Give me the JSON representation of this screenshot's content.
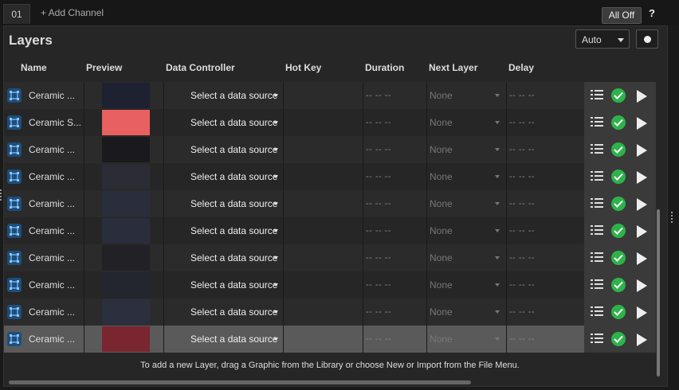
{
  "channel_tab": "01",
  "add_channel": "+ Add Channel",
  "all_off": "All Off",
  "help": "?",
  "panel_title": "Layers",
  "mode_select": "Auto",
  "columns": {
    "name": "Name",
    "preview": "Preview",
    "data_controller": "Data Controller",
    "hot_key": "Hot Key",
    "duration": "Duration",
    "next_layer": "Next Layer",
    "delay": "Delay"
  },
  "rows": [
    {
      "name": "Ceramic ...",
      "data_controller": "Select a data source",
      "duration": "-- -- --",
      "next_layer": "None",
      "delay": "-- -- --",
      "preview_color": "#1e2230"
    },
    {
      "name": "Ceramic S...",
      "data_controller": "Select a data source",
      "duration": "-- -- --",
      "next_layer": "None",
      "delay": "-- -- --",
      "preview_color": "#e86060"
    },
    {
      "name": "Ceramic ...",
      "data_controller": "Select a data source",
      "duration": "-- -- --",
      "next_layer": "None",
      "delay": "-- -- --",
      "preview_color": "#1a1a1e"
    },
    {
      "name": "Ceramic ...",
      "data_controller": "Select a data source",
      "duration": "-- -- --",
      "next_layer": "None",
      "delay": "-- -- --",
      "preview_color": "#2c2c36"
    },
    {
      "name": "Ceramic ...",
      "data_controller": "Select a data source",
      "duration": "-- -- --",
      "next_layer": "None",
      "delay": "-- -- --",
      "preview_color": "#2a2e3c"
    },
    {
      "name": "Ceramic ...",
      "data_controller": "Select a data source",
      "duration": "-- -- --",
      "next_layer": "None",
      "delay": "-- -- --",
      "preview_color": "#2a2e3c"
    },
    {
      "name": "Ceramic ...",
      "data_controller": "Select a data source",
      "duration": "-- -- --",
      "next_layer": "None",
      "delay": "-- -- --",
      "preview_color": "#222226"
    },
    {
      "name": "Ceramic ...",
      "data_controller": "Select a data source",
      "duration": "-- -- --",
      "next_layer": "None",
      "delay": "-- -- --",
      "preview_color": "#23252f"
    },
    {
      "name": "Ceramic ...",
      "data_controller": "Select a data source",
      "duration": "-- -- --",
      "next_layer": "None",
      "delay": "-- -- --",
      "preview_color": "#2c2f3d"
    },
    {
      "name": "Ceramic ...",
      "data_controller": "Select a data source",
      "duration": "-- -- --",
      "next_layer": "None",
      "delay": "-- -- --",
      "preview_color": "#7a2630",
      "selected": true
    }
  ],
  "footer_hint": "To add a new Layer, drag a Graphic from the Library or choose New or Import from the File Menu.",
  "icons": {
    "layer": "layer-graphic-icon",
    "list": "list-icon",
    "status": "check-circle-icon",
    "play": "play-icon"
  },
  "colors": {
    "accent_green": "#2db34a",
    "layer_icon_bg": "#1d4e7a",
    "selected_row": "#5a5a5a"
  }
}
